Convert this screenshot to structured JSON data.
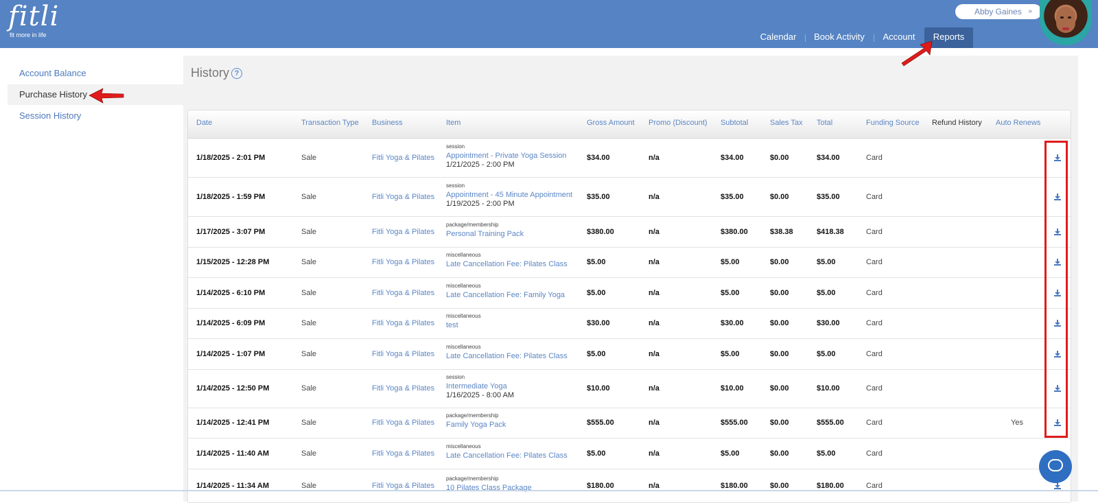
{
  "brand": {
    "name": "fitli",
    "tagline": "fit more in life"
  },
  "user": {
    "name": "Abby Gaines",
    "chevron": "»"
  },
  "nav": [
    "Calendar",
    "Book Activity",
    "Account",
    "Reports"
  ],
  "sidebar": [
    "Account Balance",
    "Purchase History",
    "Session History"
  ],
  "page": {
    "title": "History",
    "help": "?"
  },
  "columns": [
    "Date",
    "Transaction Type",
    "Business",
    "Item",
    "Gross Amount",
    "Promo (Discount)",
    "Subtotal",
    "Sales Tax",
    "Total",
    "Funding Source",
    "Refund History",
    "Auto Renews"
  ],
  "rows": [
    {
      "date": "1/18/2025 - 2:01 PM",
      "type": "Sale",
      "business": "Fitli Yoga & Pilates",
      "category": "session",
      "item": "Appointment - Private Yoga Session",
      "item_date": "1/21/2025 - 2:00 PM",
      "gross": "$34.00",
      "promo": "n/a",
      "subtotal": "$34.00",
      "tax": "$0.00",
      "total": "$34.00",
      "funding": "Card",
      "auto": ""
    },
    {
      "date": "1/18/2025 - 1:59 PM",
      "type": "Sale",
      "business": "Fitli Yoga & Pilates",
      "category": "session",
      "item": "Appointment - 45 Minute Appointment",
      "item_date": "1/19/2025 - 2:00 PM",
      "gross": "$35.00",
      "promo": "n/a",
      "subtotal": "$35.00",
      "tax": "$0.00",
      "total": "$35.00",
      "funding": "Card",
      "auto": ""
    },
    {
      "date": "1/17/2025 - 3:07 PM",
      "type": "Sale",
      "business": "Fitli Yoga & Pilates",
      "category": "package/membership",
      "item": "Personal Training Pack",
      "item_date": "",
      "gross": "$380.00",
      "promo": "n/a",
      "subtotal": "$380.00",
      "tax": "$38.38",
      "total": "$418.38",
      "funding": "Card",
      "auto": ""
    },
    {
      "date": "1/15/2025 - 12:28 PM",
      "type": "Sale",
      "business": "Fitli Yoga & Pilates",
      "category": "miscellaneous",
      "item": "Late Cancellation Fee: Pilates Class",
      "item_date": "",
      "gross": "$5.00",
      "promo": "n/a",
      "subtotal": "$5.00",
      "tax": "$0.00",
      "total": "$5.00",
      "funding": "Card",
      "auto": ""
    },
    {
      "date": "1/14/2025 - 6:10 PM",
      "type": "Sale",
      "business": "Fitli Yoga & Pilates",
      "category": "miscellaneous",
      "item": "Late Cancellation Fee: Family Yoga",
      "item_date": "",
      "gross": "$5.00",
      "promo": "n/a",
      "subtotal": "$5.00",
      "tax": "$0.00",
      "total": "$5.00",
      "funding": "Card",
      "auto": ""
    },
    {
      "date": "1/14/2025 - 6:09 PM",
      "type": "Sale",
      "business": "Fitli Yoga & Pilates",
      "category": "miscellaneous",
      "item": "test",
      "item_date": "",
      "gross": "$30.00",
      "promo": "n/a",
      "subtotal": "$30.00",
      "tax": "$0.00",
      "total": "$30.00",
      "funding": "Card",
      "auto": ""
    },
    {
      "date": "1/14/2025 - 1:07 PM",
      "type": "Sale",
      "business": "Fitli Yoga & Pilates",
      "category": "miscellaneous",
      "item": "Late Cancellation Fee: Pilates Class",
      "item_date": "",
      "gross": "$5.00",
      "promo": "n/a",
      "subtotal": "$5.00",
      "tax": "$0.00",
      "total": "$5.00",
      "funding": "Card",
      "auto": ""
    },
    {
      "date": "1/14/2025 - 12:50 PM",
      "type": "Sale",
      "business": "Fitli Yoga & Pilates",
      "category": "session",
      "item": "Intermediate Yoga",
      "item_date": "1/16/2025 - 8:00 AM",
      "gross": "$10.00",
      "promo": "n/a",
      "subtotal": "$10.00",
      "tax": "$0.00",
      "total": "$10.00",
      "funding": "Card",
      "auto": ""
    },
    {
      "date": "1/14/2025 - 12:41 PM",
      "type": "Sale",
      "business": "Fitli Yoga & Pilates",
      "category": "package/membership",
      "item": "Family Yoga Pack",
      "item_date": "",
      "gross": "$555.00",
      "promo": "n/a",
      "subtotal": "$555.00",
      "tax": "$0.00",
      "total": "$555.00",
      "funding": "Card",
      "auto": "Yes"
    },
    {
      "date": "1/14/2025 - 11:40 AM",
      "type": "Sale",
      "business": "Fitli Yoga & Pilates",
      "category": "miscellaneous",
      "item": "Late Cancellation Fee: Pilates Class",
      "item_date": "",
      "gross": "$5.00",
      "promo": "n/a",
      "subtotal": "$5.00",
      "tax": "$0.00",
      "total": "$5.00",
      "funding": "Card",
      "auto": ""
    },
    {
      "date": "1/14/2025 - 11:34 AM",
      "type": "Sale",
      "business": "Fitli Yoga & Pilates",
      "category": "package/membership",
      "item": "10 Pilates Class Package",
      "item_date": "",
      "gross": "$180.00",
      "promo": "n/a",
      "subtotal": "$180.00",
      "tax": "$0.00",
      "total": "$180.00",
      "funding": "Card",
      "auto": ""
    }
  ],
  "icons": {
    "download": "download-icon",
    "chat": "chat-icon",
    "help": "help-icon"
  },
  "colors": {
    "header": "#5583c3",
    "active_tab": "#3c629b",
    "link": "#5b86c5",
    "highlight": "#e01b1b"
  }
}
